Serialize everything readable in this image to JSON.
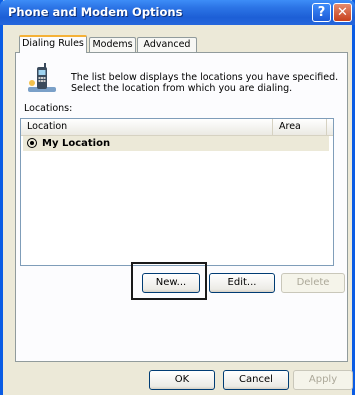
{
  "window": {
    "title": "Phone and Modem Options"
  },
  "title_buttons": {
    "help": "?",
    "close": "✕"
  },
  "tabs": [
    {
      "label": "Dialing Rules",
      "active": true
    },
    {
      "label": "Modems",
      "active": false
    },
    {
      "label": "Advanced",
      "active": false
    }
  ],
  "info_text": "The list below displays the locations you have specified. Select the location from which you are dialing.",
  "locations_label": "Locations:",
  "list": {
    "columns": [
      "Location",
      "Area Code"
    ],
    "rows": [
      {
        "location": "My Location",
        "area_code": ""
      }
    ]
  },
  "buttons": {
    "new": "New...",
    "edit": "Edit...",
    "delete": "Delete",
    "ok": "OK",
    "cancel": "Cancel",
    "apply": "Apply"
  },
  "colors": {
    "title_blue": "#1d5fd6",
    "frame_blue": "#0a5ce4",
    "dialog_bg": "#ece9d8",
    "tab_accent": "#f5b137"
  }
}
